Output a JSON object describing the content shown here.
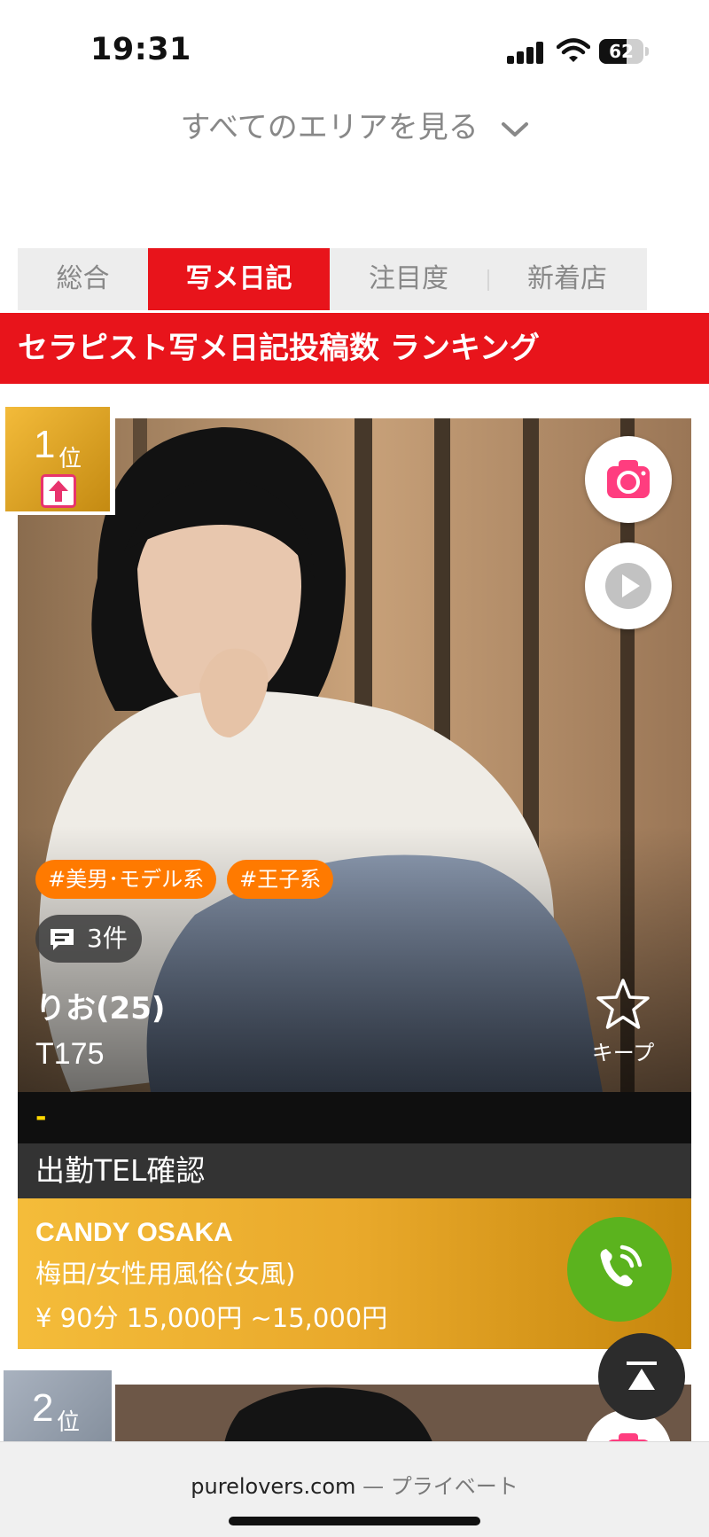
{
  "status": {
    "time": "19:31",
    "battery": "62",
    "battery_level": 0.62
  },
  "area_link": {
    "label": "すべてのエリアを見る",
    "icon": "chevron-down-icon"
  },
  "tabs": [
    {
      "label": "総合",
      "active": false
    },
    {
      "label": "写メ日記",
      "active": true
    },
    {
      "label": "注目度",
      "active": false
    },
    {
      "label": "新着店",
      "active": false
    }
  ],
  "ranking_title": "セラピスト写メ日記投稿数 ランキング",
  "cards": [
    {
      "rank_num": "1",
      "rank_unit": "位",
      "rank_trend": "up-arrow-icon",
      "tags": [
        "#美男･モデル系",
        "#王子系"
      ],
      "comments": "3件",
      "name": "りお(25)",
      "height": "T175",
      "keep_label": "キープ",
      "status_dash": "-",
      "work_info": "出勤TEL確認",
      "shop_name": "CANDY OSAKA",
      "shop_area": "梅田/女性用風俗(女風)",
      "price": "¥ 90分 15,000円 ~15,000円"
    },
    {
      "rank_num": "2",
      "rank_unit": "位"
    }
  ],
  "browser": {
    "domain": "purelovers.com",
    "separator": " — ",
    "mode": "プライベート"
  },
  "colors": {
    "accent_red": "#e8141b",
    "tag_orange": "#ff7a00",
    "gold": "#e9a92b",
    "call_green": "#5bb31e",
    "camera_pink": "#ff3d7f"
  }
}
